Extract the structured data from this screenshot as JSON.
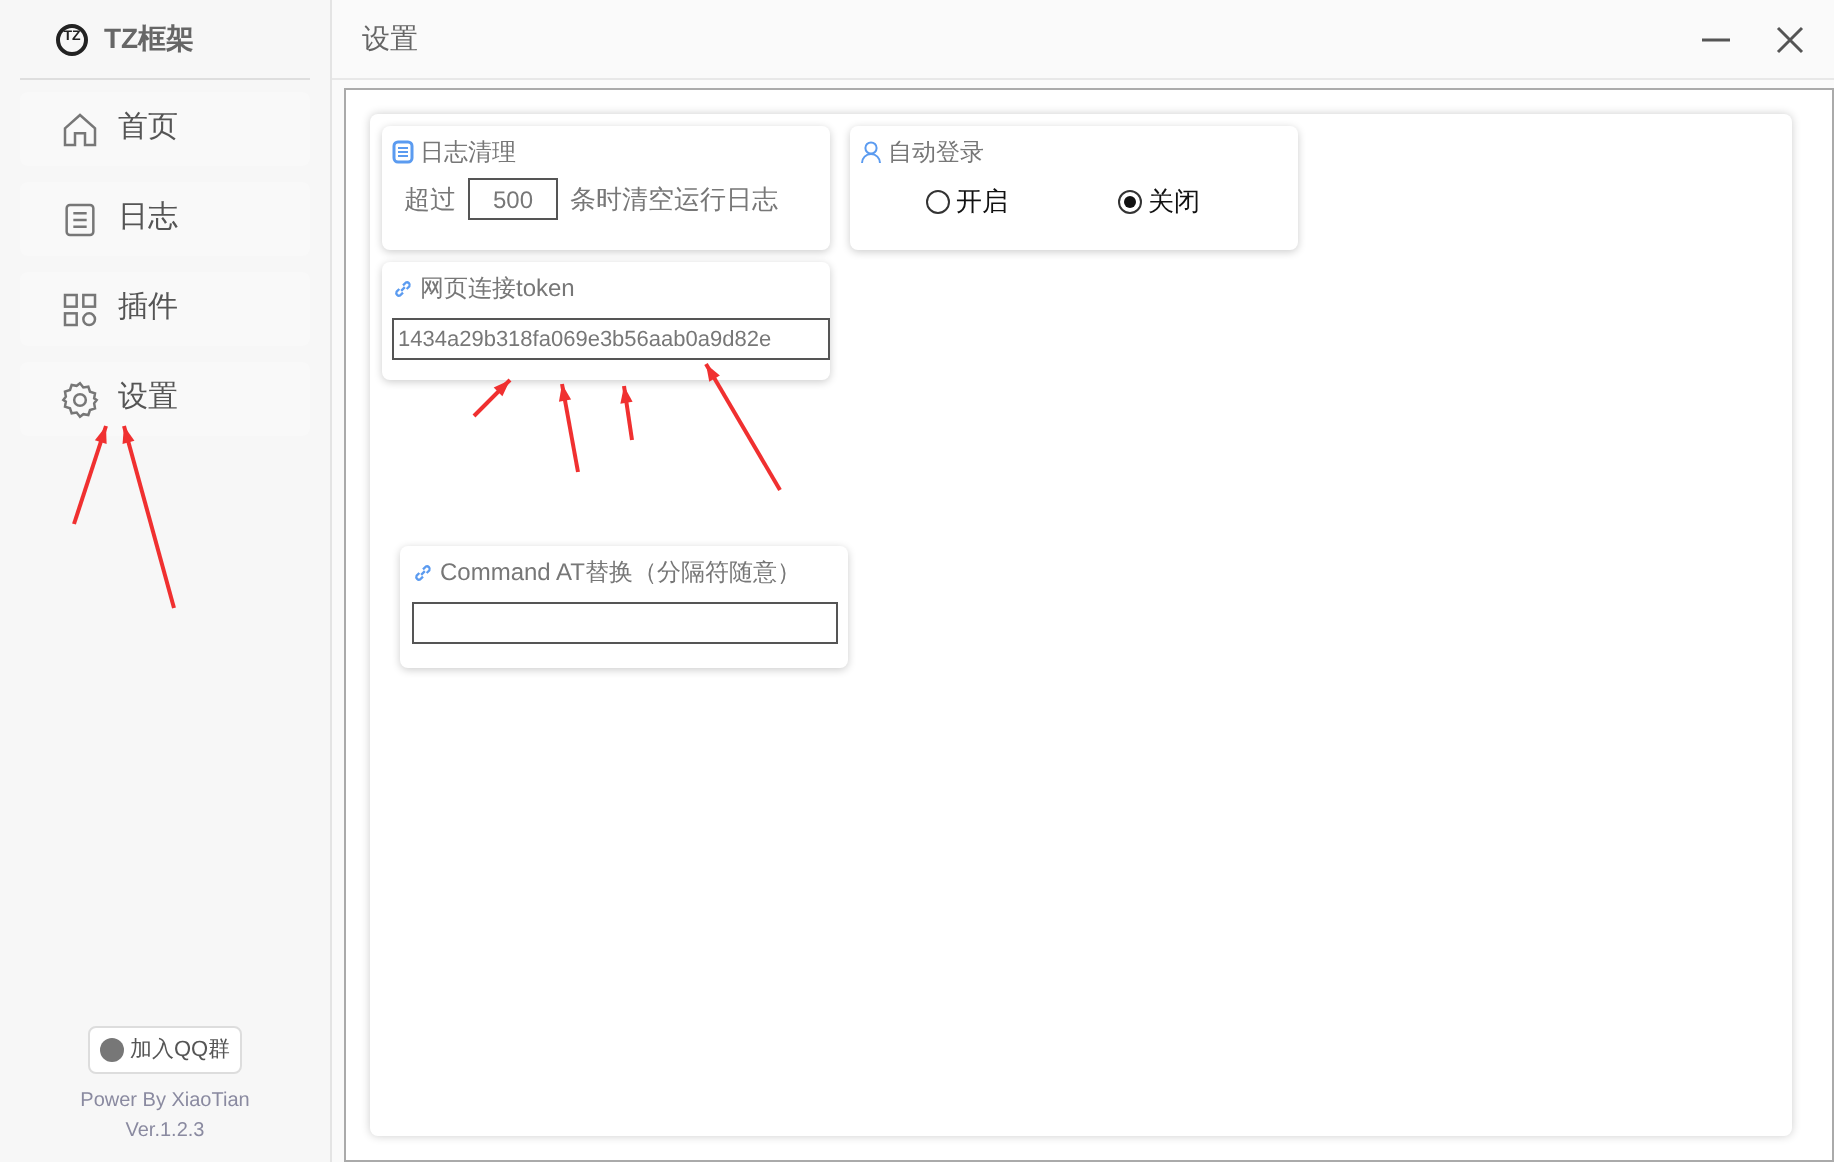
{
  "app": {
    "logo": "TZ",
    "name": "TZ框架"
  },
  "sidebar": {
    "items": [
      {
        "label": "首页"
      },
      {
        "label": "日志"
      },
      {
        "label": "插件"
      },
      {
        "label": "设置"
      }
    ],
    "join_button": "加入QQ群",
    "credit": "Power By XiaoTian",
    "version": "Ver.1.2.3"
  },
  "window": {
    "title": "设置"
  },
  "log_cleanup": {
    "title": "日志清理",
    "prefix": "超过",
    "value": "500",
    "suffix": "条时清空运行日志"
  },
  "auto_login": {
    "title": "自动登录",
    "options": [
      {
        "label": "开启",
        "selected": false
      },
      {
        "label": "关闭",
        "selected": true
      }
    ]
  },
  "token": {
    "title": "网页连接token",
    "value": "1434a29b318fa069e3b56aab0a9d82e"
  },
  "command_at": {
    "title": "Command AT替换（分隔符随意）"
  }
}
